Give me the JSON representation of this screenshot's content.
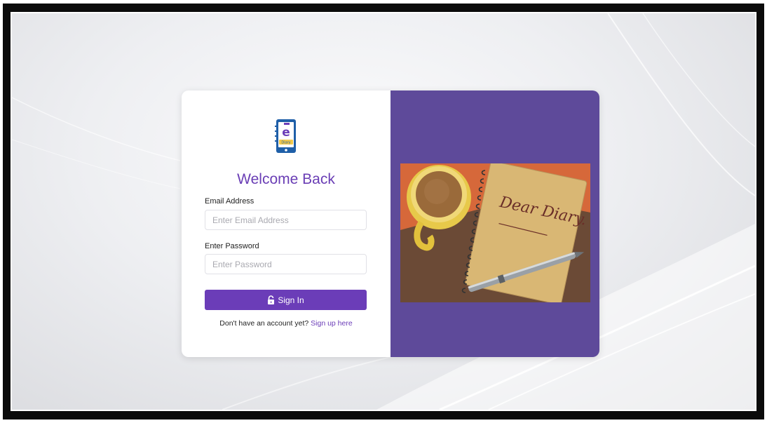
{
  "login": {
    "logo_text": "Diary",
    "logo_letter": "e",
    "title": "Welcome Back",
    "email": {
      "label": "Email Address",
      "placeholder": "Enter Email Address",
      "value": ""
    },
    "password": {
      "label": "Enter Password",
      "placeholder": "Enter Password",
      "value": ""
    },
    "submit_label": "Sign In",
    "signup_prompt": "Don't have an account yet?",
    "signup_link": "Sign up here"
  },
  "hero_image": {
    "notebook_text": "Dear Diary."
  },
  "icons": {
    "submit": "lock-icon",
    "logo": "e-diary-logo-icon"
  },
  "colors": {
    "accent": "#6b3db8",
    "title": "#6a3eb5",
    "image_panel_bg": "#5e4a9a"
  }
}
